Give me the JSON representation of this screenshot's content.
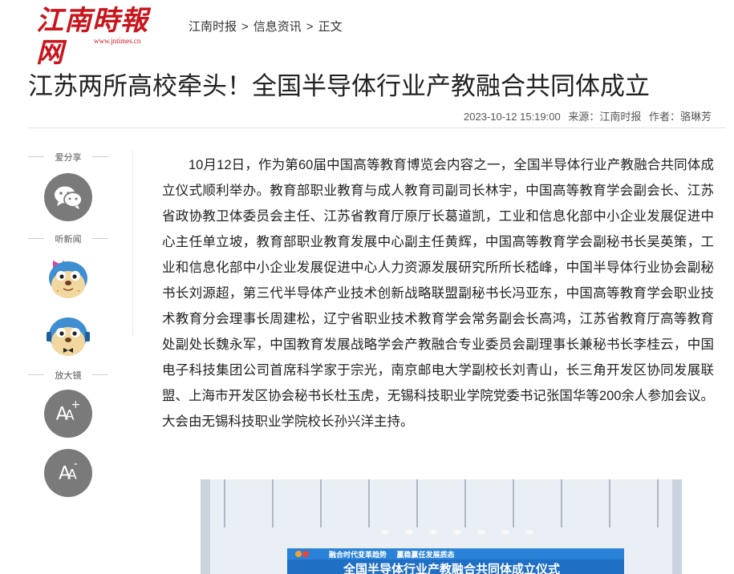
{
  "brand": {
    "logo_text": "江南時報网",
    "logo_url": "www.jntimes.cn"
  },
  "breadcrumb": {
    "items": [
      "江南时报",
      "信息资讯",
      "正文"
    ],
    "separator": ">"
  },
  "article": {
    "title": "江苏两所高校牵头！全国半导体行业产教融合共同体成立",
    "datetime": "2023-10-12 15:19:00",
    "source_label": "来源：江南时报",
    "author_label": "作者：骆琳芳",
    "paragraph": "10月12日，作为第60届中国高等教育博览会内容之一，全国半导体行业产教融合共同体成立仪式顺利举办。教育部职业教育与成人教育司副司长林宇，中国高等教育学会副会长、江苏省政协教卫体委员会主任、江苏省教育厅原厅长葛道凯，工业和信息化部中小企业发展促进中心主任单立坡，教育部职业教育发展中心副主任黄辉，中国高等教育学会副秘书长吴英策，工业和信息化部中小企业发展促进中心人力资源发展研究所所长嵇峰，中国半导体行业协会副秘书长刘源超，第三代半导体产业技术创新战略联盟副秘书长冯亚东，中国高等教育学会职业技术教育分会理事长周建松，辽宁省职业技术教育学会常务副会长高鸿，江苏省教育厅高等教育处副处长魏永军，中国教育发展战略学会产教融合专业委员会副理事长兼秘书长李桂云，中国电子科技集团公司首席科学家于宗光，南京邮电大学副校长刘青山，长三角开发区协同发展联盟、上海市开发区协会秘书长杜玉虎，无锡科技职业学院党委书记张国华等200余人参加会议。大会由无锡科技职业学院校长孙兴洋主持。"
  },
  "sidebar": {
    "share_label": "爱分享",
    "listen_label": "听新闻",
    "zoom_label": "放大镜",
    "font_increase": {
      "text": "A",
      "mark": "+"
    },
    "font_decrease": {
      "text": "A",
      "mark": "-"
    }
  },
  "photo": {
    "banner_left": "融合时代变革趋势",
    "banner_right": "赢稳赢任发展质态",
    "headline": "全国半导体行业产教融合共同体成立仪式"
  },
  "colors": {
    "brand_red": "#c8161d",
    "icon_gray": "#7a7a7a"
  }
}
